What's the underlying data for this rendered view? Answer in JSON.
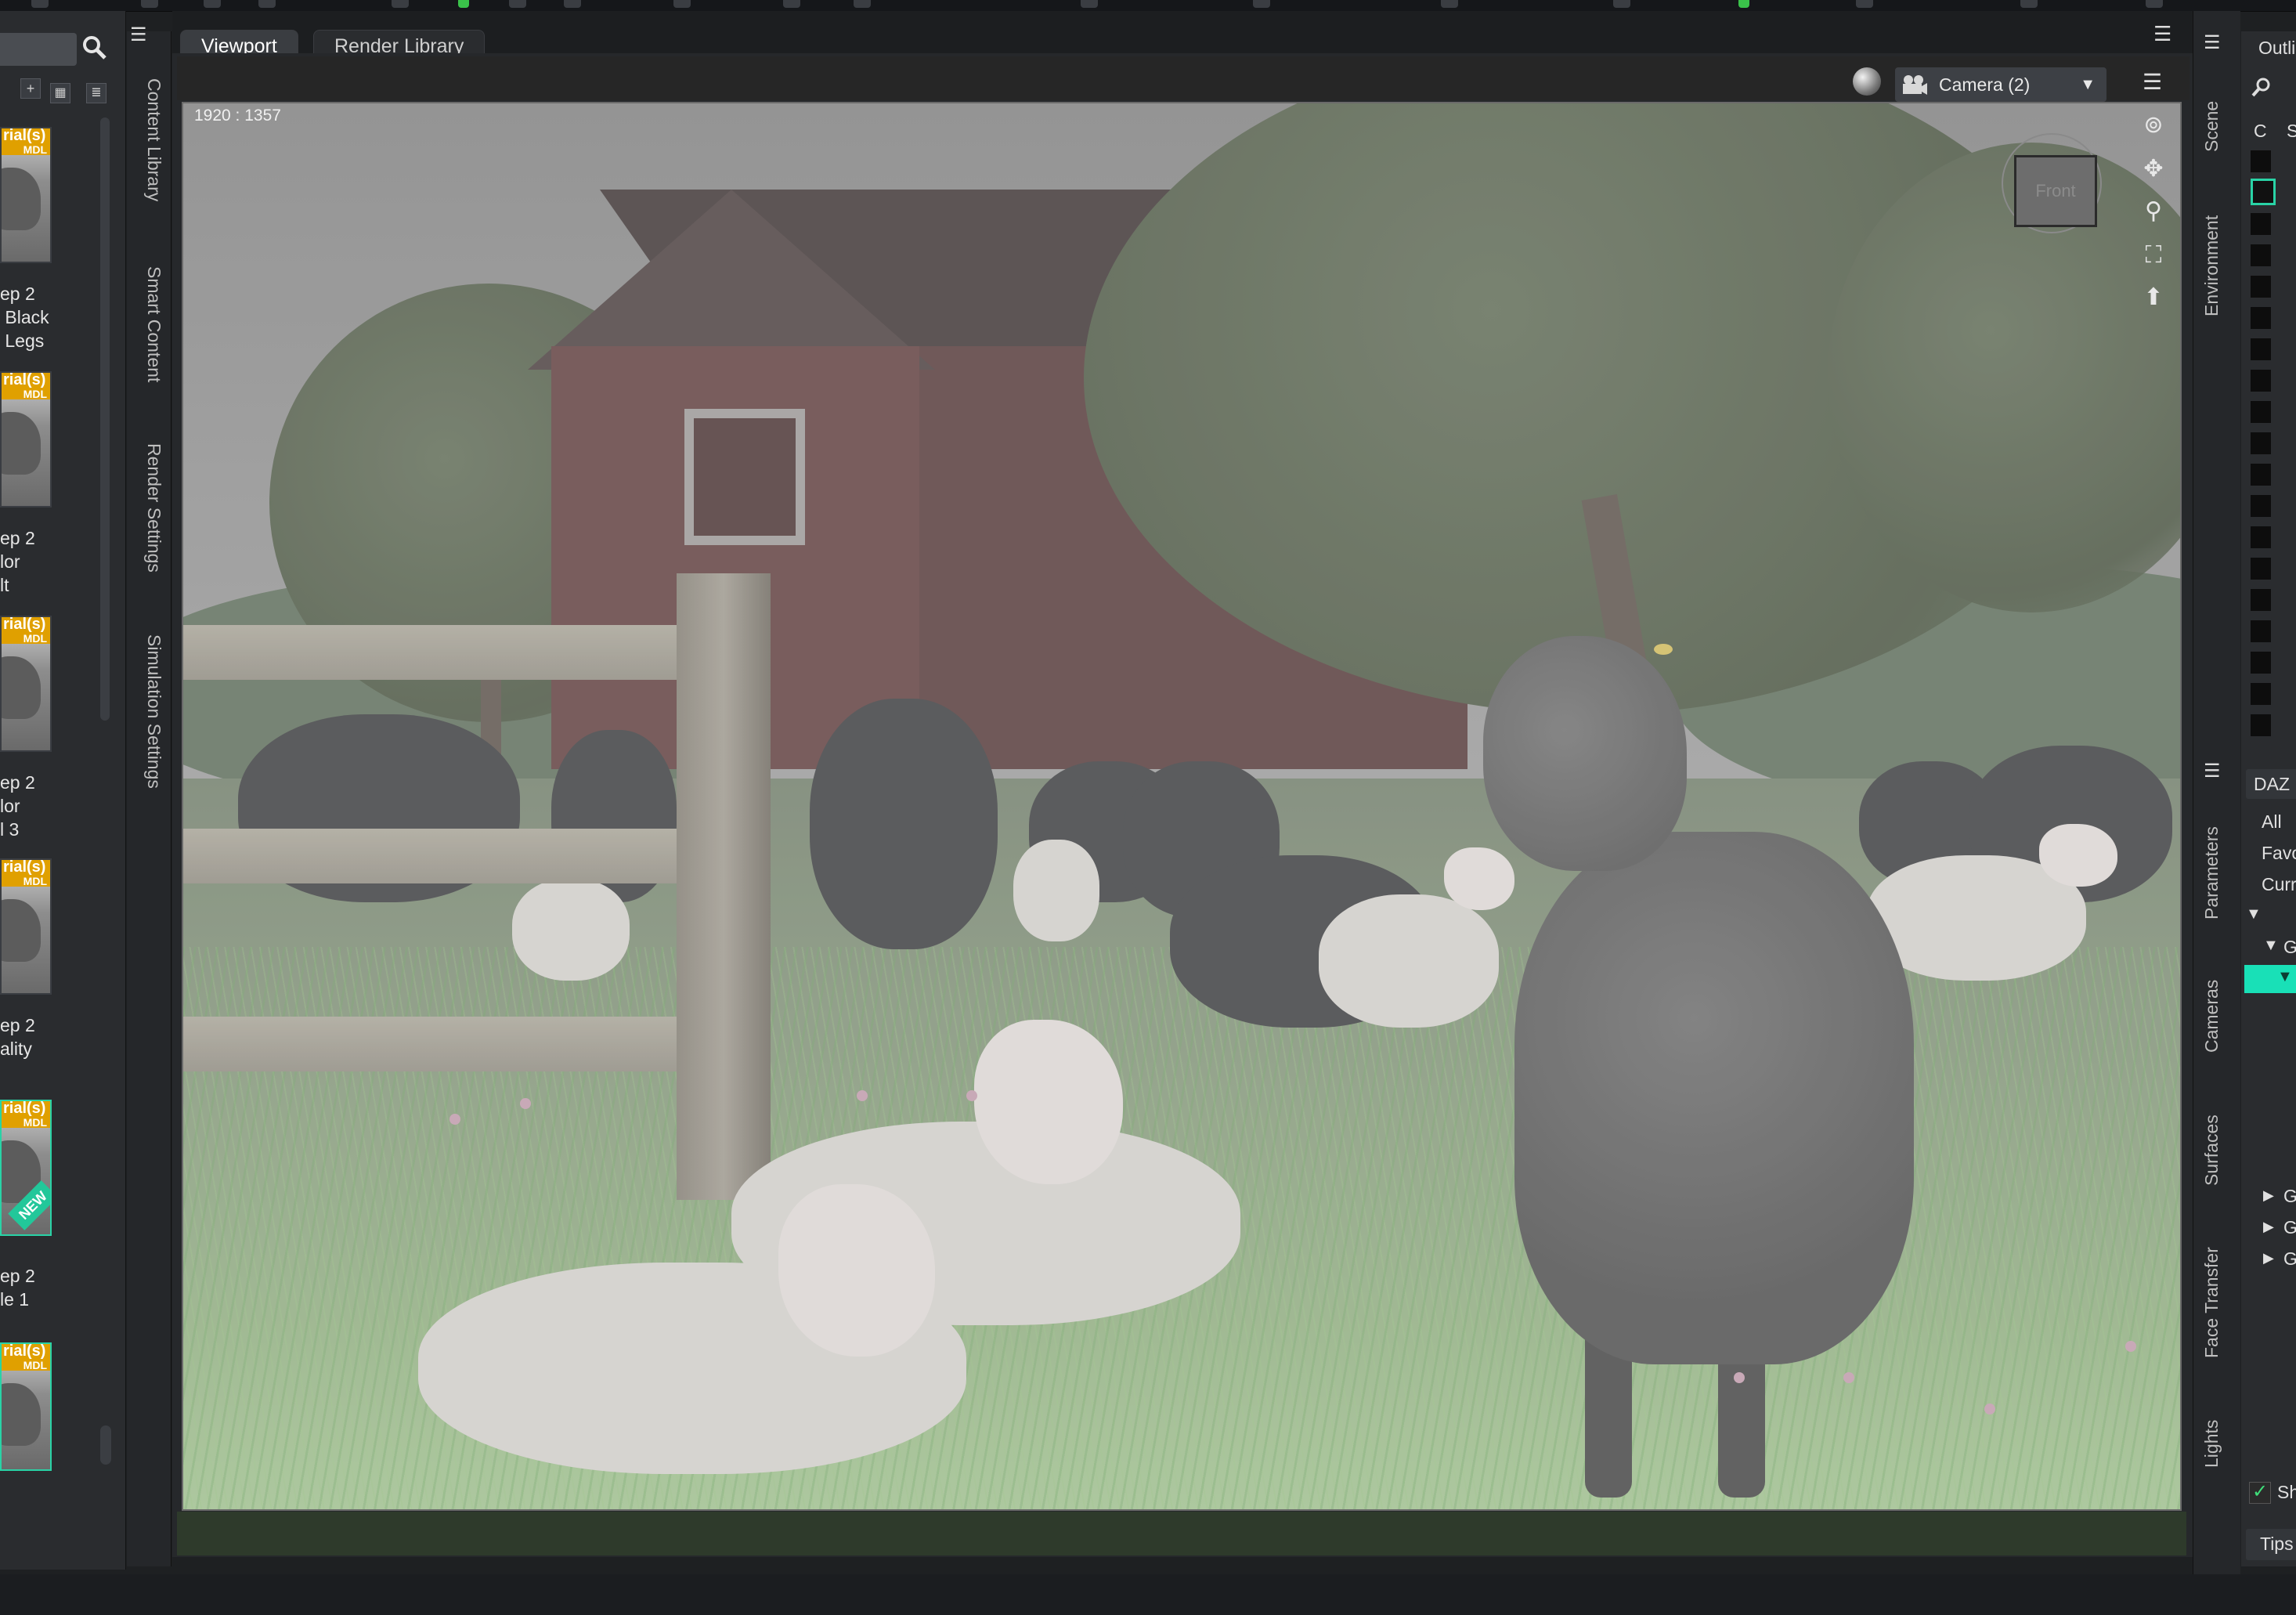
{
  "tabs": [
    {
      "label": "Viewport"
    },
    {
      "label": "Render Library"
    }
  ],
  "left_side_tabs": [
    "Content Library",
    "Smart Content",
    "Render Settings",
    "Simulation Settings"
  ],
  "right_side_tabs": [
    "Scene",
    "Environment",
    "Parameters",
    "Cameras",
    "Surfaces",
    "Face Transfer",
    "Lights"
  ],
  "viewport": {
    "aspect_label": "1920 : 1357",
    "camera": "Camera (2)",
    "nav_cube_face": "Front"
  },
  "content_library": {
    "items": [
      {
        "badge": "rial(s)",
        "badge_sub": "MDL",
        "label": "ep 2\n Black\n Legs"
      },
      {
        "badge": "rial(s)",
        "badge_sub": "MDL",
        "label": "ep 2\nlor\nlt"
      },
      {
        "badge": "rial(s)",
        "badge_sub": "MDL",
        "label": "ep 2\nlor\nl 3"
      },
      {
        "badge": "rial(s)",
        "badge_sub": "MDL",
        "label": "ep 2\nality"
      },
      {
        "badge": "rial(s)",
        "badge_sub": "MDL",
        "label": "ep 2\nle 1",
        "new": "NEW"
      },
      {
        "badge": "rial(s)",
        "badge_sub": "MDL",
        "label": ""
      }
    ]
  },
  "right_panel": {
    "header": "Outli",
    "columns": [
      "C",
      "S"
    ],
    "daz_label": "DAZ",
    "filters": [
      "All",
      "Favo",
      "Curr"
    ],
    "show_label": "Sh",
    "tips_label": "Tips",
    "group_marker": "G"
  },
  "colors": {
    "accent": "#29d3a6",
    "badge": "#e0a000",
    "selection": "#19e0b7"
  }
}
